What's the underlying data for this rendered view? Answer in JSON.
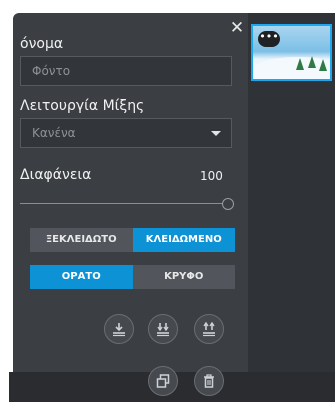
{
  "panel": {
    "name_label": "όνομα",
    "name_placeholder": "Φόντο",
    "blend_label": "Λειτουργία Μίξης",
    "blend_value": "Κανένα",
    "opacity_label": "Διαφάνεια",
    "opacity_value": "100",
    "lock_options": [
      {
        "label": "ΞΕΚΛΕΙΔΩΤΟ",
        "active": false
      },
      {
        "label": "ΚΛΕΙΔΩΜΕΝΟ",
        "active": true
      }
    ],
    "visibility_options": [
      {
        "label": "ΟΡΑΤΟ",
        "active": true
      },
      {
        "label": "ΚΡΥΦΟ",
        "active": false
      }
    ]
  },
  "thumbnail": {
    "badge": "•••"
  },
  "colors": {
    "accent": "#0d92d6",
    "panel": "#3b3f44",
    "selection": "#1da7ec"
  }
}
